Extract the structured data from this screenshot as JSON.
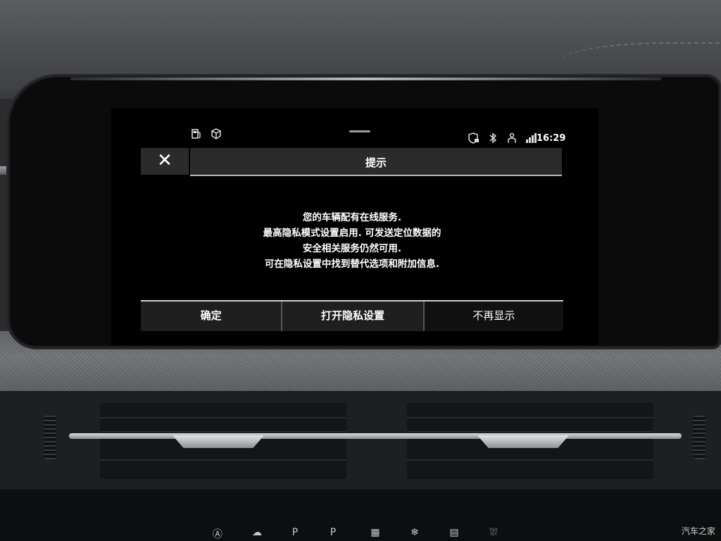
{
  "status_bar": {
    "left_icons": [
      "fuel-pump-icon",
      "cube-icon"
    ],
    "right_icons": [
      "shield-lock-icon",
      "bluetooth-icon",
      "driver-profile-icon",
      "signal-data-icon"
    ],
    "time": "16:29"
  },
  "dialog": {
    "title": "提示",
    "close_label": "✕",
    "message_lines": [
      "您的车辆配有在线服务.",
      "最高隐私模式设置启用. 可发送定位数据的",
      "安全相关服务仍然可用.",
      "可在隐私设置中找到替代选项和附加信息."
    ],
    "buttons": {
      "confirm": "确定",
      "open_privacy": "打开隐私设置",
      "dont_show_again": "不再显示"
    }
  },
  "watermark": "汽车之家",
  "climate_buttons": [
    "Ⓐ",
    "☁",
    "P",
    "P",
    "▦",
    "❄",
    "▤",
    "⛆"
  ]
}
